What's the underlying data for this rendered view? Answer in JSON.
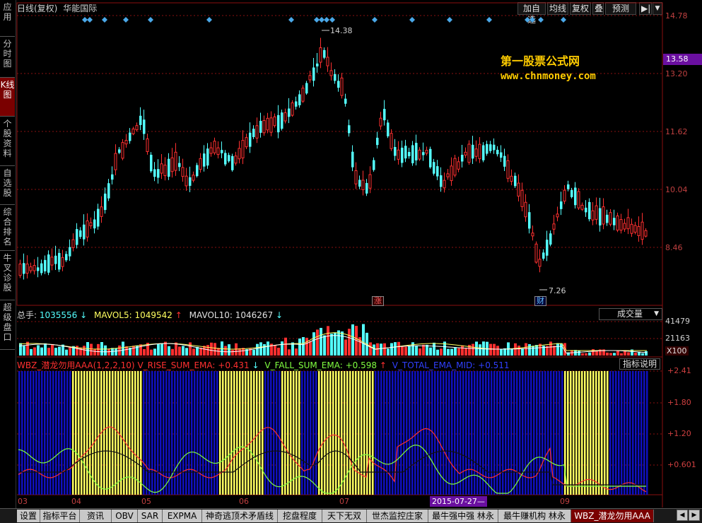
{
  "left_tabs": [
    {
      "label": "应用"
    },
    {
      "label": "分时图"
    },
    {
      "label": "K线图",
      "active": true
    },
    {
      "label": "个股资料"
    },
    {
      "label": "自选股"
    },
    {
      "label": "综合排名"
    },
    {
      "label": "牛叉诊股"
    },
    {
      "label": "超级盘口"
    }
  ],
  "header": {
    "period": "日线(复权)",
    "stock_name": "华能国际"
  },
  "toolbar": [
    {
      "label": "加自选",
      "icon": "add-icon"
    },
    {
      "label": "均线"
    },
    {
      "label": "复权"
    },
    {
      "label": "叠"
    },
    {
      "label": "预测"
    },
    {
      "label": "▶|",
      "icon": "switch-icon"
    },
    {
      "label": "▼",
      "icon": "dropdown-icon"
    }
  ],
  "watermark": {
    "line1": "第一股票公式网",
    "line2": "www.chnmoney.com"
  },
  "price_axis": {
    "ticks": [
      "14.78",
      "13.20",
      "11.62",
      "10.04",
      "8.46"
    ],
    "last_price": "13.58"
  },
  "annotations": {
    "high": "14.38",
    "low": "7.26",
    "badge_zhang": "涨",
    "badge_cai": "财"
  },
  "volume": {
    "total_label": "总手:",
    "total_value": "1035556",
    "ma5_label": "MAVOL5:",
    "ma5_value": "1049542",
    "ma10_label": "MAVOL10:",
    "ma10_value": "1046267",
    "selector": "成交量",
    "axis": [
      "41479",
      "21163"
    ],
    "unit": "X100"
  },
  "indicator": {
    "name": "WBZ_潜龙勿用AAA(1,2,2,10)",
    "rise_label": "V_RISE_SUM_EMA:",
    "rise_value": "+0.431",
    "fall_label": "V_FALL_SUM_EMA:",
    "fall_value": "+0.598",
    "total_label": "V_TOTAL_EMA_MID:",
    "total_value": "+0.511",
    "help_button": "指标说明",
    "axis": [
      "+2.41",
      "+1.80",
      "+1.20",
      "+0.601"
    ]
  },
  "x_axis": {
    "months": [
      "03",
      "04",
      "05",
      "06",
      "07",
      "09"
    ],
    "selected_date": "2015-07-27—"
  },
  "bottom_tabs": [
    {
      "label": "设置"
    },
    {
      "label": "指标平台"
    },
    {
      "label": "资讯"
    },
    {
      "label": "OBV"
    },
    {
      "label": "SAR"
    },
    {
      "label": "EXPMA"
    },
    {
      "label": "神奇逃顶术矛盾线"
    },
    {
      "label": "挖盘程度"
    },
    {
      "label": "天下无双"
    },
    {
      "label": "世杰监控庄家"
    },
    {
      "label": "最牛强中强 林永"
    },
    {
      "label": "最牛赚机构 林永"
    },
    {
      "label": "WBZ_潜龙勿用AAA",
      "active": true
    }
  ],
  "colors": {
    "up": "#ff3030",
    "down": "#54ffff",
    "grid": "#8a1010",
    "blue_bar": "#1010c0",
    "yellow_bar": "#ffff60"
  }
}
